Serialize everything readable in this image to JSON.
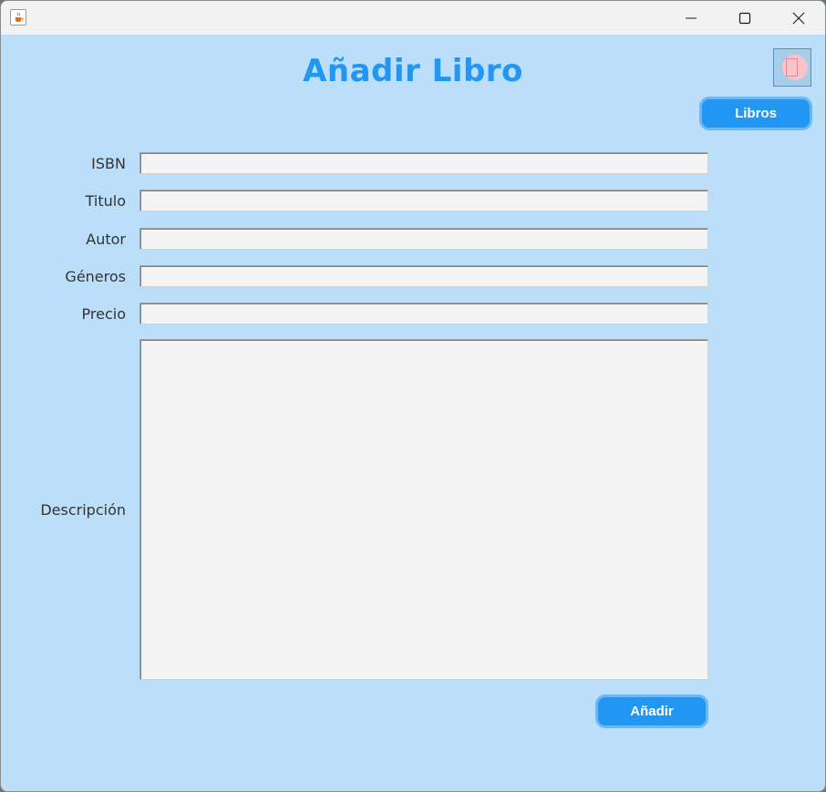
{
  "window": {
    "controls": {
      "minimize": "minimize-icon",
      "maximize": "maximize-icon",
      "close": "close-icon"
    },
    "app_icon": "java-coffee-icon"
  },
  "header": {
    "title": "Añadir Libro",
    "corner_icon": "image-icon",
    "libros_button": "Libros"
  },
  "form": {
    "fields": [
      {
        "label": "ISBN",
        "value": ""
      },
      {
        "label": "Titulo",
        "value": ""
      },
      {
        "label": "Autor",
        "value": ""
      },
      {
        "label": "Géneros",
        "value": ""
      },
      {
        "label": "Precio",
        "value": ""
      }
    ],
    "descripcion": {
      "label": "Descripción",
      "value": ""
    },
    "submit_label": "Añadir"
  },
  "colors": {
    "background": "#bbdef9",
    "accent": "#2196f3",
    "button_border": "#6cb8f5",
    "field_background": "#f4f4f4"
  }
}
